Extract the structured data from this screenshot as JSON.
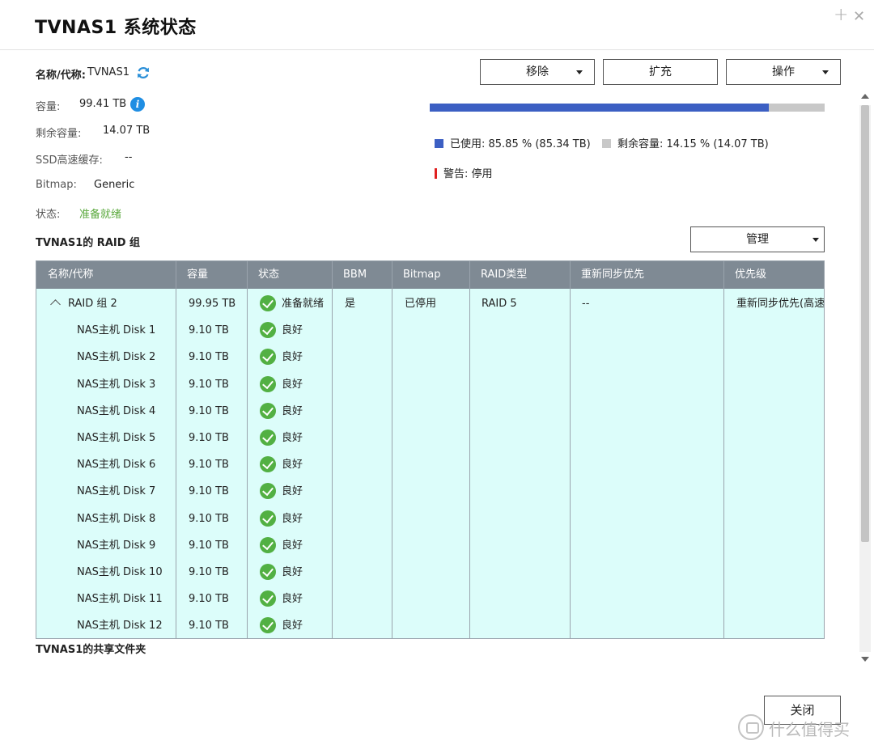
{
  "window": {
    "title": "TVNAS1  系统状态",
    "add_glyph": "+",
    "close_glyph": "✕"
  },
  "info": {
    "name_label": "名称/代称:",
    "name_value": "TVNAS1",
    "capacity_label": "容量:",
    "capacity_value": "99.41 TB",
    "free_label": "剩余容量:",
    "free_value": "14.07 TB",
    "ssd_label": "SSD高速缓存:",
    "ssd_value": "--",
    "bitmap_label": "Bitmap:",
    "bitmap_value": "Generic",
    "status_label": "状态:",
    "status_value": "准备就绪",
    "status_color": "#5aa83c",
    "info_glyph": "i"
  },
  "toolbar": {
    "remove_label": "移除",
    "expand_label": "扩充",
    "action_label": "操作"
  },
  "usage": {
    "used_fraction": 0.8585,
    "used_color": "#3c5fc3",
    "free_color": "#c8c8c8",
    "used_text": "已使用: 85.85 % (85.34 TB)",
    "free_text": "剩余容量: 14.15 % (14.07 TB)",
    "warning_text": "警告: 停用",
    "warning_color": "#e02020"
  },
  "raid_section": {
    "title": "TVNAS1的 RAID 组",
    "manage_label": "管理"
  },
  "table": {
    "headers": [
      "名称/代称",
      "容量",
      "状态",
      "BBM",
      "Bitmap",
      "RAID类型",
      "重新同步优先",
      "优先级"
    ],
    "group_row": {
      "name": "RAID 组 2",
      "capacity": "99.95 TB",
      "status": "准备就绪",
      "bbm": "是",
      "bitmap": "已停用",
      "raid_type": "RAID 5",
      "resync": "--",
      "priority": "重新同步优先(高速"
    },
    "disks": [
      {
        "name": "NAS主机 Disk 1",
        "capacity": "9.10 TB",
        "status": "良好"
      },
      {
        "name": "NAS主机 Disk 2",
        "capacity": "9.10 TB",
        "status": "良好"
      },
      {
        "name": "NAS主机 Disk 3",
        "capacity": "9.10 TB",
        "status": "良好"
      },
      {
        "name": "NAS主机 Disk 4",
        "capacity": "9.10 TB",
        "status": "良好"
      },
      {
        "name": "NAS主机 Disk 5",
        "capacity": "9.10 TB",
        "status": "良好"
      },
      {
        "name": "NAS主机 Disk 6",
        "capacity": "9.10 TB",
        "status": "良好"
      },
      {
        "name": "NAS主机 Disk 7",
        "capacity": "9.10 TB",
        "status": "良好"
      },
      {
        "name": "NAS主机 Disk 8",
        "capacity": "9.10 TB",
        "status": "良好"
      },
      {
        "name": "NAS主机 Disk 9",
        "capacity": "9.10 TB",
        "status": "良好"
      },
      {
        "name": "NAS主机 Disk 10",
        "capacity": "9.10 TB",
        "status": "良好"
      },
      {
        "name": "NAS主机 Disk 11",
        "capacity": "9.10 TB",
        "status": "良好"
      },
      {
        "name": "NAS主机 Disk 12",
        "capacity": "9.10 TB",
        "status": "良好"
      }
    ]
  },
  "shared_section": {
    "title": "TVNAS1的共享文件夹"
  },
  "footer": {
    "close_label": "关闭"
  },
  "watermark": {
    "text": "什么值得买"
  }
}
